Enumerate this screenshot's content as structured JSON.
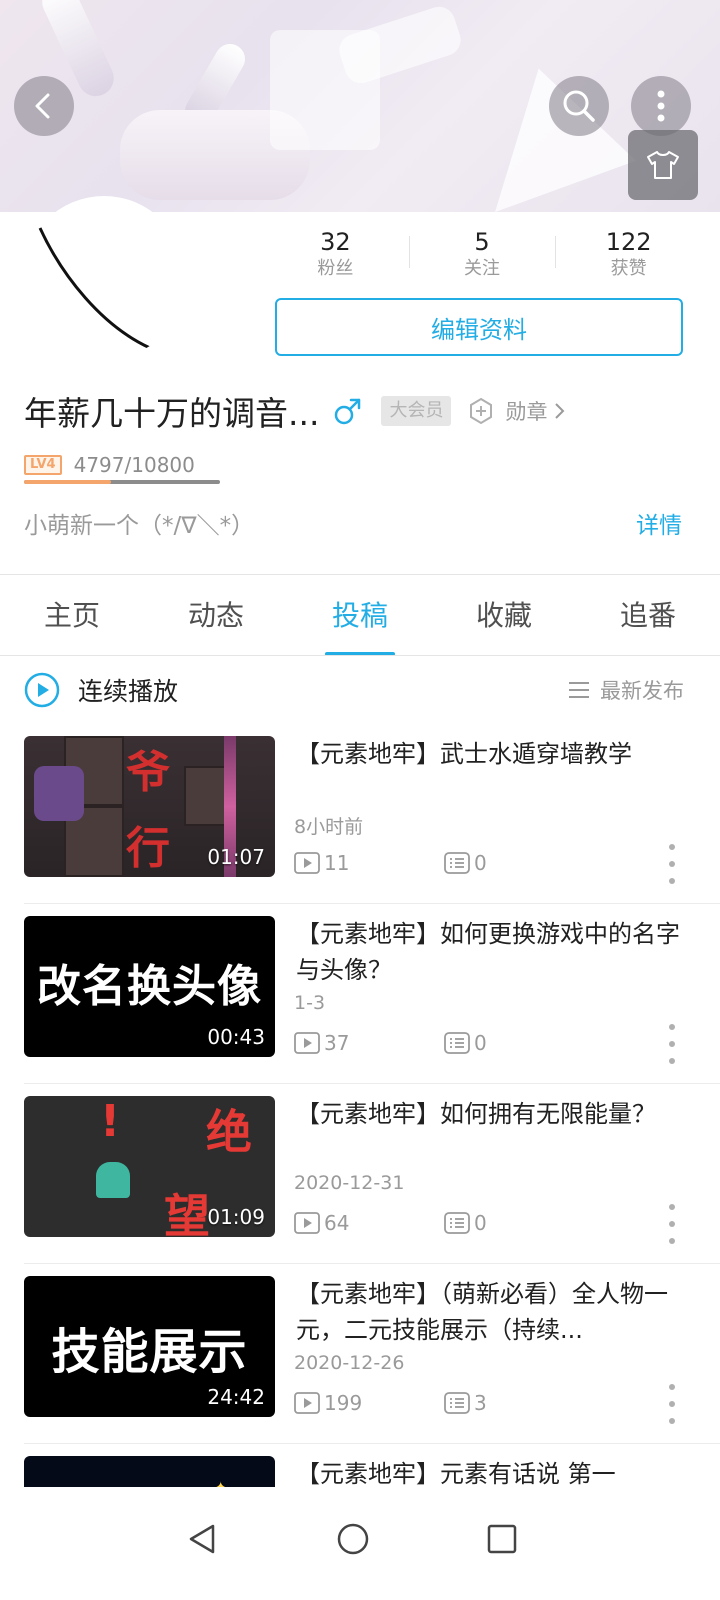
{
  "header": {
    "back_icon": "back-arrow-icon",
    "search_icon": "search-icon",
    "more_icon": "more-vertical-icon",
    "theme_icon": "tshirt-icon"
  },
  "profile": {
    "stats": [
      {
        "value": "32",
        "label": "粉丝"
      },
      {
        "value": "5",
        "label": "关注"
      },
      {
        "value": "122",
        "label": "获赞"
      }
    ],
    "edit_label": "编辑资料",
    "username": "年薪几十万的调音...",
    "gender": "male",
    "vip_label": "大会员",
    "medal_label": "勋章",
    "level_label": "LV4",
    "exp_text": "4797/10800",
    "exp_progress": 0.444,
    "signature": "小萌新一个（*/∇＼*）",
    "detail_link": "详情"
  },
  "tabs": [
    {
      "label": "主页",
      "active": false
    },
    {
      "label": "动态",
      "active": false
    },
    {
      "label": "投稿",
      "active": true
    },
    {
      "label": "收藏",
      "active": false
    },
    {
      "label": "追番",
      "active": false
    }
  ],
  "toolbar": {
    "play_all_label": "连续播放",
    "sort_label": "最新发布"
  },
  "videos": [
    {
      "title": "【元素地牢】武士水遁穿墙教学",
      "date": "8小时前",
      "duration": "01:07",
      "plays": "11",
      "comments": "0",
      "thumb_text": ""
    },
    {
      "title": "【元素地牢】如何更换游戏中的名字与头像？",
      "date": "1-3",
      "duration": "00:43",
      "plays": "37",
      "comments": "0",
      "thumb_text": "改名换头像"
    },
    {
      "title": "【元素地牢】如何拥有无限能量？",
      "date": "2020-12-31",
      "duration": "01:09",
      "plays": "64",
      "comments": "0",
      "thumb_text": ""
    },
    {
      "title": "【元素地牢】（萌新必看）全人物一元，二元技能展示（持续...",
      "date": "2020-12-26",
      "duration": "24:42",
      "plays": "199",
      "comments": "3",
      "thumb_text": "技能展示"
    },
    {
      "title": "【元素地牢】元素有话说 第一",
      "date": "",
      "duration": "",
      "plays": "",
      "comments": "",
      "thumb_text": ""
    }
  ],
  "colors": {
    "accent": "#23ade5",
    "level": "#f3a56c"
  }
}
